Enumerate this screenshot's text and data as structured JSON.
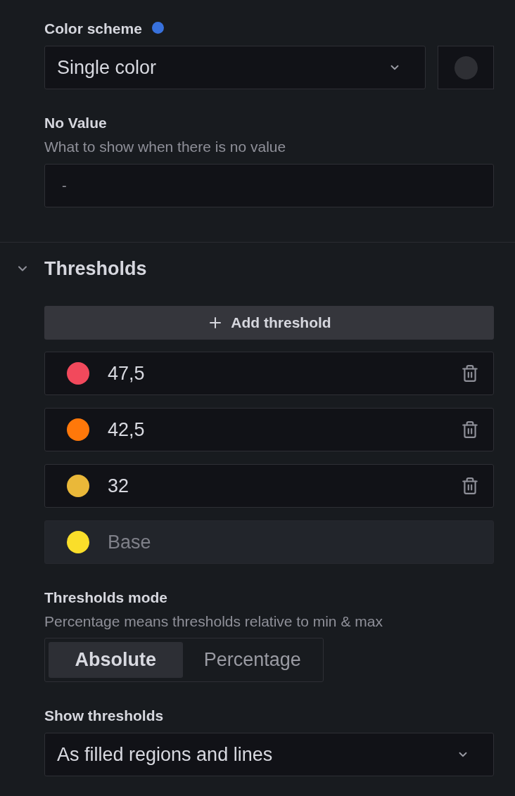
{
  "color_scheme": {
    "label": "Color scheme",
    "modified": true,
    "value": "Single color"
  },
  "no_value": {
    "label": "No Value",
    "description": "What to show when there is no value",
    "placeholder": "-"
  },
  "thresholds": {
    "title": "Thresholds",
    "expanded": true,
    "add_button": "Add threshold",
    "items": [
      {
        "kind": "value",
        "value": "47,5",
        "color": "#f2495c"
      },
      {
        "kind": "value",
        "value": "42,5",
        "color": "#ff780a"
      },
      {
        "kind": "value",
        "value": "32",
        "color": "#eab839"
      },
      {
        "kind": "base",
        "value": "Base",
        "color": "#fade2a"
      }
    ]
  },
  "thresholds_mode": {
    "label": "Thresholds mode",
    "description": "Percentage means thresholds relative to min & max",
    "options": [
      {
        "label": "Absolute",
        "selected": true
      },
      {
        "label": "Percentage",
        "selected": false
      }
    ]
  },
  "show_thresholds": {
    "label": "Show thresholds",
    "value": "As filled regions and lines"
  }
}
